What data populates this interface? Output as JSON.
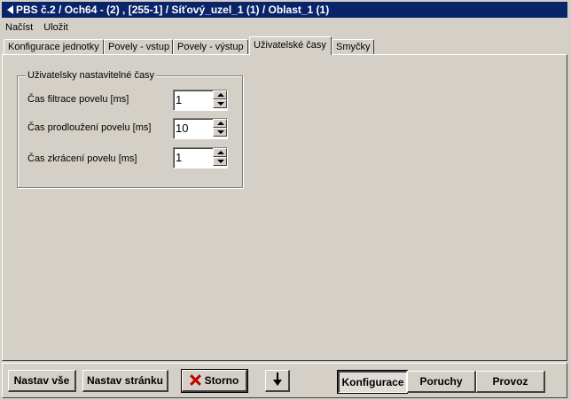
{
  "window": {
    "title": "PBS č.2 / Och64 - (2) , [255-1] / Síťový_uzel_1 (1) / Oblast_1 (1)"
  },
  "menu": {
    "items": [
      "Načíst",
      "Uložit"
    ]
  },
  "tabs": [
    {
      "label": "Konfigurace jednotky",
      "active": false
    },
    {
      "label": "Povely - vstup",
      "active": false
    },
    {
      "label": "Povely - výstup",
      "active": false
    },
    {
      "label": "Uživatelské časy",
      "active": true
    },
    {
      "label": "Smyčky",
      "active": false
    }
  ],
  "group": {
    "title": "Uživatelsky nastavitelné časy",
    "rows": [
      {
        "label": "Čas filtrace povelu [ms]",
        "value": "1"
      },
      {
        "label": "Čas prodloužení povelu [ms]",
        "value": "10"
      },
      {
        "label": "Čas zkrácení povelu [ms]",
        "value": "1"
      }
    ]
  },
  "bottom": {
    "set_all": "Nastav vše",
    "set_page": "Nastav stránku",
    "cancel": "Storno",
    "mode_configuration": "Konfigurace",
    "mode_faults": "Poruchy",
    "mode_operation": "Provoz"
  },
  "icons": {
    "title_icon": "arrow-left-icon",
    "cancel_icon": "red-x-icon",
    "down_icon": "arrow-down-icon"
  },
  "colors": {
    "titlebar": "#0a246a",
    "face": "#d4d0c8",
    "cancel_x": "#c00000"
  }
}
